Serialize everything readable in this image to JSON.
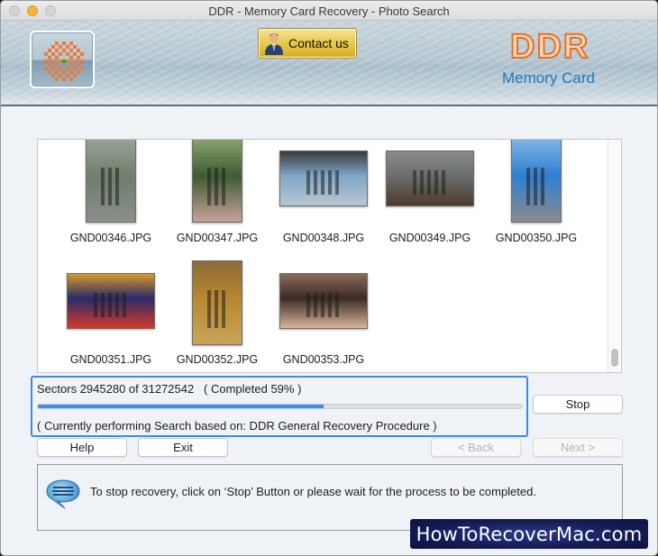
{
  "window": {
    "title": "DDR - Memory Card Recovery - Photo Search"
  },
  "header": {
    "logo_icon": "ddr-logo-icon",
    "contact_button": {
      "label": "Contact us",
      "icon": "person-icon"
    },
    "brand": {
      "name": "DDR",
      "subtitle": "Memory Card"
    },
    "colors": {
      "brand_orange": "#e86f2a",
      "brand_blue": "#1f78b8"
    }
  },
  "photos": [
    {
      "filename": "GND00346.JPG",
      "orientation": "portrait",
      "palette": [
        "#6e7f6a",
        "#9aa39a",
        "#8a8f8c"
      ]
    },
    {
      "filename": "GND00347.JPG",
      "orientation": "portrait",
      "palette": [
        "#3f5b33",
        "#8aa46b",
        "#c6a29b"
      ]
    },
    {
      "filename": "GND00348.JPG",
      "orientation": "landscape",
      "palette": [
        "#7fa6c6",
        "#3a3a3a",
        "#b8c6d2"
      ]
    },
    {
      "filename": "GND00349.JPG",
      "orientation": "landscape",
      "palette": [
        "#6b6f70",
        "#8a8a86",
        "#4d3a2a"
      ]
    },
    {
      "filename": "GND00350.JPG",
      "orientation": "portrait",
      "palette": [
        "#2f7fd0",
        "#7fb6e6",
        "#8b8b8b"
      ]
    },
    {
      "filename": "GND00351.JPG",
      "orientation": "landscape",
      "palette": [
        "#2a2a6a",
        "#d79a2a",
        "#d23a2a"
      ]
    },
    {
      "filename": "GND00352.JPG",
      "orientation": "portrait",
      "palette": [
        "#b8872f",
        "#8a6a3a",
        "#c9a55a"
      ]
    },
    {
      "filename": "GND00353.JPG",
      "orientation": "landscape",
      "palette": [
        "#3b2a25",
        "#8a6a5a",
        "#d6b59a"
      ]
    }
  ],
  "progress": {
    "sectors_text": "Sectors 2945280 of 31272542   ( Completed 59% )",
    "sectors_done": 2945280,
    "sectors_total": 31272542,
    "completed_percent": 59,
    "current_text": "( Currently performing Search based on: DDR General Recovery Procedure )",
    "bar_color": "#3d8ee4"
  },
  "buttons": {
    "stop": "Stop",
    "help": "Help",
    "exit": "Exit",
    "back": "< Back",
    "next": "Next >"
  },
  "info": {
    "icon": "speech-bubble-icon",
    "message": "To stop recovery, click on ‘Stop’ Button or please wait for the process to be completed."
  },
  "watermark": {
    "text": "HowToRecoverMac.com"
  }
}
